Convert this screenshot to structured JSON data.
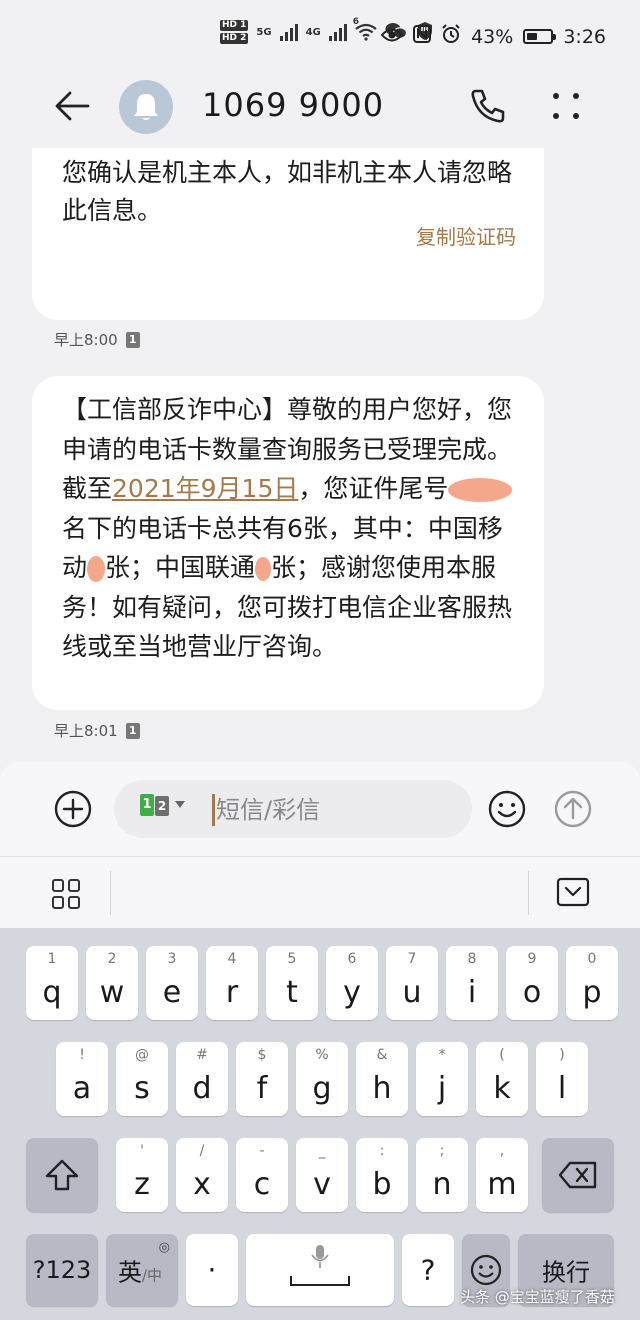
{
  "status_bar": {
    "hd1": "HD 1",
    "hd2": "HD 2",
    "net1": "5G",
    "net2": "4G",
    "wifi": "6",
    "battery_percent": "43%",
    "battery_level": 0.43,
    "time": "3:26"
  },
  "header": {
    "title": "1069 9000"
  },
  "messages": [
    {
      "text": "您确认是机主本人，如非机主本人请忽略此信息。",
      "action": "复制验证码",
      "time": "早上8:00",
      "sim": "1"
    },
    {
      "part1": "【工信部反诈中心】尊敬的用户您好，您申请的电话卡数量查询服务已受理完成。截至",
      "date_link": "2021年9月15日",
      "part2": "，您证件尾号",
      "part3": "名下的电话卡总共有6张，其中：中国移动",
      "part4": "张；中国联通",
      "part5": "张；感谢您使用本服务！如有疑问，您可拨打电信企业客服热线或至当地营业厅咨询。",
      "time": "早上8:01",
      "sim": "1"
    }
  ],
  "composer": {
    "sim1": "1",
    "sim2": "2",
    "placeholder": "短信/彩信"
  },
  "keyboard": {
    "row1": [
      {
        "main": "q",
        "sub": "1"
      },
      {
        "main": "w",
        "sub": "2"
      },
      {
        "main": "e",
        "sub": "3"
      },
      {
        "main": "r",
        "sub": "4"
      },
      {
        "main": "t",
        "sub": "5"
      },
      {
        "main": "y",
        "sub": "6"
      },
      {
        "main": "u",
        "sub": "7"
      },
      {
        "main": "i",
        "sub": "8"
      },
      {
        "main": "o",
        "sub": "9"
      },
      {
        "main": "p",
        "sub": "0"
      }
    ],
    "row2": [
      {
        "main": "a",
        "sub": "!"
      },
      {
        "main": "s",
        "sub": "@"
      },
      {
        "main": "d",
        "sub": "#"
      },
      {
        "main": "f",
        "sub": "$"
      },
      {
        "main": "g",
        "sub": "%"
      },
      {
        "main": "h",
        "sub": "&"
      },
      {
        "main": "j",
        "sub": "*"
      },
      {
        "main": "k",
        "sub": "("
      },
      {
        "main": "l",
        "sub": ")"
      }
    ],
    "row3": [
      {
        "main": "z",
        "sub": "'"
      },
      {
        "main": "x",
        "sub": "/"
      },
      {
        "main": "c",
        "sub": "-"
      },
      {
        "main": "v",
        "sub": "_"
      },
      {
        "main": "b",
        "sub": ":"
      },
      {
        "main": "n",
        "sub": ";"
      },
      {
        "main": "m",
        "sub": ","
      }
    ],
    "num_key": "?123",
    "lang_key": "英",
    "lang_sub": "/中",
    "dot_key": "·",
    "question_key": "?",
    "enter_key": "换行"
  },
  "watermark": "头条 @宝宝蓝瘦了香菇",
  "colors": {
    "accent": "#a47a4a",
    "sim_green": "#3eae49",
    "avatar": "#b9c7d6",
    "keyboard_bg": "#d5d7de"
  }
}
